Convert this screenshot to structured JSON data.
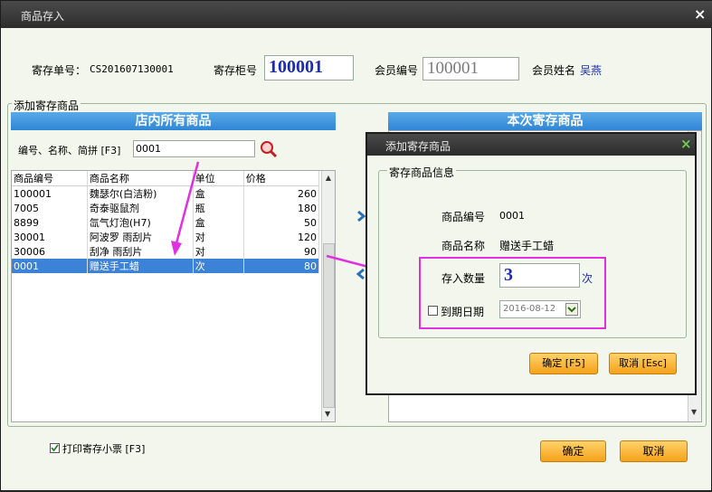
{
  "window": {
    "title": "商品存入",
    "close": "×"
  },
  "header": {
    "deposit_no_label": "寄存单号：",
    "deposit_no_value": "CS201607130001",
    "cabinet_label": "寄存柜号",
    "cabinet_value": "100001",
    "member_no_label": "会员编号",
    "member_no_value": "100001",
    "member_name_label": "会员姓名",
    "member_name_value": "吴燕"
  },
  "add_group_label": "添加寄存商品",
  "left_panel": {
    "title": "店内所有商品",
    "search_label": "编号、名称、简拼 [F3]",
    "search_value": "0001",
    "columns": [
      "商品编号",
      "商品名称",
      "单位",
      "价格"
    ],
    "rows": [
      {
        "code": "100001",
        "name": "魏瑟尔(白洁粉)",
        "unit": "盒",
        "price": "260"
      },
      {
        "code": "7005",
        "name": "奇泰驱鼠剂",
        "unit": "瓶",
        "price": "180"
      },
      {
        "code": "8899",
        "name": "氙气灯泡(H7)",
        "unit": "盒",
        "price": "50"
      },
      {
        "code": "30001",
        "name": "阿波罗 雨刮片",
        "unit": "对",
        "price": "120"
      },
      {
        "code": "30006",
        "name": "刮净 雨刮片",
        "unit": "对",
        "price": "90"
      },
      {
        "code": "0001",
        "name": "赠送手工蜡",
        "unit": "次",
        "price": "80"
      }
    ],
    "selected_index": 5
  },
  "right_panel": {
    "title": "本次寄存商品"
  },
  "dialog": {
    "title": "添加寄存商品",
    "close": "×",
    "group_label": "寄存商品信息",
    "code_label": "商品编号",
    "code_value": "0001",
    "name_label": "商品名称",
    "name_value": "赠送手工蜡",
    "qty_label": "存入数量",
    "qty_value": "3",
    "qty_unit": "次",
    "expiry_label": "到期日期",
    "expiry_checked": false,
    "expiry_value": "2016-08-12",
    "ok_label": "确定 [F5]",
    "cancel_label": "取消 [Esc]"
  },
  "footer": {
    "print_label": "打印寄存小票 [F3]",
    "print_checked": true,
    "ok_label": "确定",
    "cancel_label": "取消"
  },
  "colors": {
    "accent_blue": "#2f86d6",
    "selection": "#3c82d6",
    "annotation": "#e030e0",
    "button_orange": "#f4a21a"
  }
}
